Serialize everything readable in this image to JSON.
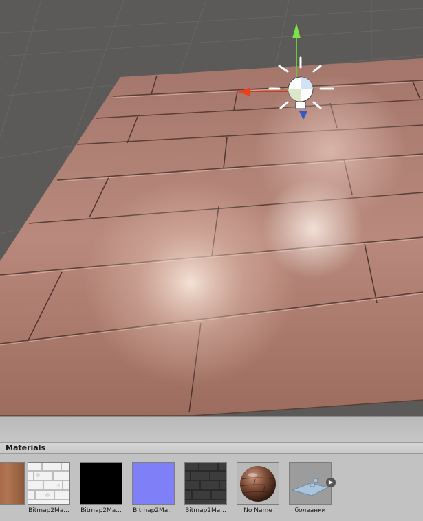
{
  "panel": {
    "title": "Materials"
  },
  "assets": [
    {
      "label": "",
      "icon": "wood-texture-thumbnail-icon"
    },
    {
      "label": "Bitmap2Ma...",
      "icon": "brick-diffuse-map-icon"
    },
    {
      "label": "Bitmap2Ma...",
      "icon": "black-map-icon"
    },
    {
      "label": "Bitmap2Ma...",
      "icon": "normal-map-icon"
    },
    {
      "label": "Bitmap2Ma...",
      "icon": "brick-dark-map-icon"
    },
    {
      "label": "No Name",
      "icon": "material-sphere-icon"
    },
    {
      "label": "болванки",
      "icon": "prefab-icon"
    }
  ],
  "gizmo": {
    "icon": "point-light-icon",
    "axes": [
      "y-axis-green",
      "x-axis-red",
      "z-axis-blue"
    ]
  },
  "colors": {
    "scene_bg": "#5c5a58",
    "panel_bg": "#c2c2c2",
    "wood": "#b6877a",
    "normal_map": "#7f7ff8"
  }
}
